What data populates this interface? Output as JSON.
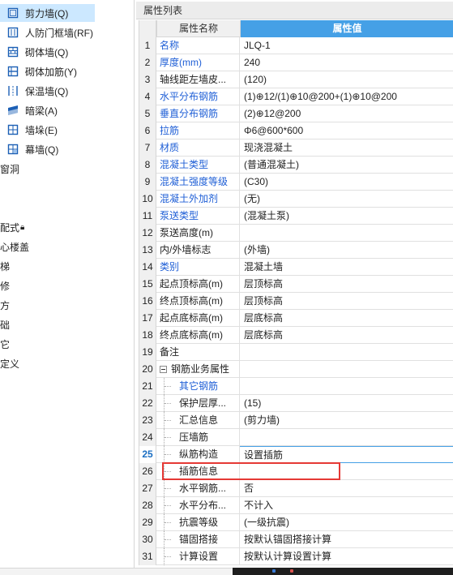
{
  "tree": {
    "items": [
      {
        "label": "剪力墙(Q)",
        "icon": "shear-wall-icon",
        "selected": true
      },
      {
        "label": "人防门框墙(RF)",
        "icon": "door-frame-wall-icon"
      },
      {
        "label": "砌体墙(Q)",
        "icon": "masonry-wall-icon"
      },
      {
        "label": "砌体加筋(Y)",
        "icon": "masonry-rebar-icon"
      },
      {
        "label": "保温墙(Q)",
        "icon": "insulation-wall-icon"
      },
      {
        "label": "暗梁(A)",
        "icon": "hidden-beam-icon"
      },
      {
        "label": "墙垛(E)",
        "icon": "wall-pier-icon"
      },
      {
        "label": "幕墙(Q)",
        "icon": "curtain-wall-icon"
      }
    ],
    "categories": [
      "窗洞",
      "",
      "",
      "配式",
      "心楼盖",
      "梯",
      "修",
      "方",
      "础",
      "它",
      "定义"
    ]
  },
  "panel": {
    "title": "属性列表",
    "header_name": "属性名称",
    "header_value": "属性值"
  },
  "rows": [
    {
      "num": "1",
      "name": "名称",
      "value": "JLQ-1",
      "blue": true
    },
    {
      "num": "2",
      "name": "厚度(mm)",
      "value": "240",
      "blue": true
    },
    {
      "num": "3",
      "name": "轴线距左墙皮...",
      "value": "(120)",
      "blue": false
    },
    {
      "num": "4",
      "name": "水平分布钢筋",
      "value": "(1)⊕12/(1)⊕10@200+(1)⊕10@200",
      "blue": true
    },
    {
      "num": "5",
      "name": "垂直分布钢筋",
      "value": "(2)⊕12@200",
      "blue": true
    },
    {
      "num": "6",
      "name": "拉筋",
      "value": "Φ6@600*600",
      "blue": true
    },
    {
      "num": "7",
      "name": "材质",
      "value": "现浇混凝土",
      "blue": true
    },
    {
      "num": "8",
      "name": "混凝土类型",
      "value": "(普通混凝土)",
      "blue": true
    },
    {
      "num": "9",
      "name": "混凝土强度等级",
      "value": "(C30)",
      "blue": true
    },
    {
      "num": "10",
      "name": "混凝土外加剂",
      "value": "(无)",
      "blue": true
    },
    {
      "num": "11",
      "name": "泵送类型",
      "value": "(混凝土泵)",
      "blue": true
    },
    {
      "num": "12",
      "name": "泵送高度(m)",
      "value": "",
      "blue": false
    },
    {
      "num": "13",
      "name": "内/外墙标志",
      "value": "(外墙)",
      "blue": false
    },
    {
      "num": "14",
      "name": "类别",
      "value": "混凝土墙",
      "blue": true
    },
    {
      "num": "15",
      "name": "起点顶标高(m)",
      "value": "层顶标高",
      "blue": false
    },
    {
      "num": "16",
      "name": "终点顶标高(m)",
      "value": "层顶标高",
      "blue": false
    },
    {
      "num": "17",
      "name": "起点底标高(m)",
      "value": "层底标高",
      "blue": false
    },
    {
      "num": "18",
      "name": "终点底标高(m)",
      "value": "层底标高",
      "blue": false
    },
    {
      "num": "19",
      "name": "备注",
      "value": "",
      "blue": false
    },
    {
      "num": "20",
      "name": "钢筋业务属性",
      "value": "",
      "blue": false,
      "group": true
    },
    {
      "num": "21",
      "name": "其它钢筋",
      "value": "",
      "blue": true,
      "child": true
    },
    {
      "num": "22",
      "name": "保护层厚...",
      "value": "(15)",
      "blue": false,
      "child": true
    },
    {
      "num": "23",
      "name": "汇总信息",
      "value": "(剪力墙)",
      "blue": false,
      "child": true
    },
    {
      "num": "24",
      "name": "压墙筋",
      "value": "",
      "blue": false,
      "child": true
    },
    {
      "num": "25",
      "name": "纵筋构造",
      "value": "设置插筋",
      "blue": false,
      "child": true,
      "active": true
    },
    {
      "num": "26",
      "name": "插筋信息",
      "value": "",
      "blue": false,
      "child": true
    },
    {
      "num": "27",
      "name": "水平钢筋...",
      "value": "否",
      "blue": false,
      "child": true
    },
    {
      "num": "28",
      "name": "水平分布...",
      "value": "不计入",
      "blue": false,
      "child": true
    },
    {
      "num": "29",
      "name": "抗震等级",
      "value": "(一级抗震)",
      "blue": false,
      "child": true
    },
    {
      "num": "30",
      "name": "锚固搭接",
      "value": "按默认锚固搭接计算",
      "blue": false,
      "child": true
    },
    {
      "num": "31",
      "name": "计算设置",
      "value": "按默认计算设置计算",
      "blue": false,
      "child": true
    }
  ],
  "colors": {
    "accent": "#45a0e6",
    "link_blue": "#1f5fd6",
    "selection": "#cce8ff",
    "highlight_box": "#e53935"
  }
}
